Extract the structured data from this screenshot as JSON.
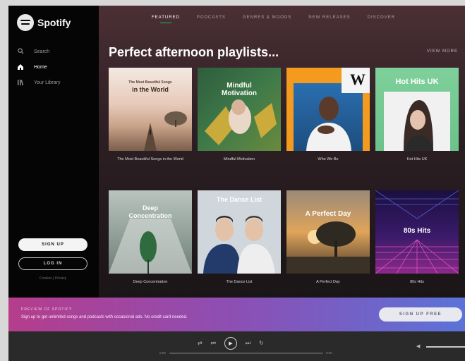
{
  "app": {
    "name": "Spotify"
  },
  "sidebar": {
    "items": [
      {
        "label": "Search",
        "icon": "search-icon",
        "active": false
      },
      {
        "label": "Home",
        "icon": "home-icon",
        "active": true
      },
      {
        "label": "Your Library",
        "icon": "library-icon",
        "active": false
      }
    ],
    "signup_label": "SIGN UP",
    "login_label": "LOG IN",
    "footer_links": "Cookies  |  Privacy"
  },
  "tabs": [
    {
      "label": "FEATURED",
      "active": true
    },
    {
      "label": "PODCASTS",
      "active": false
    },
    {
      "label": "GENRES & MOODS",
      "active": false
    },
    {
      "label": "NEW RELEASES",
      "active": false
    },
    {
      "label": "DISCOVER",
      "active": false
    }
  ],
  "main": {
    "heading": "Perfect afternoon playlists...",
    "view_more": "VIEW MORE"
  },
  "playlists": [
    {
      "title": "The Most Beautiful Songs in the World",
      "cover_text": "The Most Beautiful Songs\nin the World"
    },
    {
      "title": "Mindful Motivation",
      "cover_text": "Mindful\nMotivation"
    },
    {
      "title": "Who We Be",
      "cover_text": "W"
    },
    {
      "title": "Hot Hits UK",
      "cover_text": "Hot Hits UK"
    },
    {
      "title": "Deep Concentration",
      "cover_text": "Deep\nConcentration"
    },
    {
      "title": "The Dance List",
      "cover_text": "The Dance List"
    },
    {
      "title": "A Perfect Day",
      "cover_text": "A Perfect Day"
    },
    {
      "title": "80s Hits",
      "cover_text": "80s Hits"
    }
  ],
  "banner": {
    "label": "PREVIEW OF SPOTIFY",
    "text": "Sign up to get unlimited songs and podcasts with occasional ads. No credit card needed.",
    "button_label": "SIGN UP FREE"
  },
  "player": {
    "time_elapsed": "0:00",
    "time_total": "0:00"
  },
  "colors": {
    "accent": "#1db954",
    "banner_start": "#b53d8c",
    "banner_end": "#5b73d8"
  }
}
